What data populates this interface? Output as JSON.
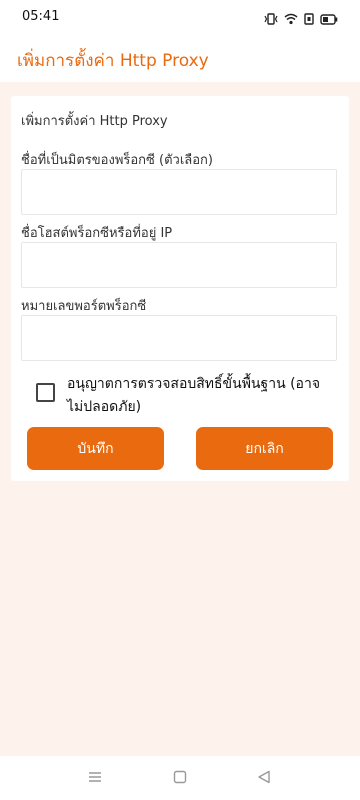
{
  "status_bar": {
    "time": "05:41",
    "icons": [
      "vibrate-icon",
      "wifi-icon",
      "sim-icon",
      "battery-icon"
    ]
  },
  "app_bar": {
    "title": "เพิ่มการตั้งค่า Http Proxy"
  },
  "form": {
    "card_title": "เพิ่มการตั้งค่า Http Proxy",
    "friendly_name": {
      "label": "ชื่อที่เป็นมิตรของพร็อกซี (ตัวเลือก)",
      "value": ""
    },
    "host": {
      "label": "ชื่อโฮสต์พร็อกซีหรือที่อยู่ IP",
      "value": ""
    },
    "port": {
      "label": "หมายเลขพอร์ตพร็อกซี",
      "value": ""
    },
    "insecure_auth": {
      "label": "อนุญาตการตรวจสอบสิทธิ์ขั้นพื้นฐาน (อาจไม่ปลอดภัย)",
      "checked": false
    },
    "save_label": "บันทึก",
    "cancel_label": "ยกเลิก"
  },
  "nav_bar": {
    "icons": [
      "menu-icon",
      "home-icon",
      "back-icon"
    ]
  },
  "colors": {
    "accent": "#ea6a10",
    "background": "#fdf3ec"
  }
}
